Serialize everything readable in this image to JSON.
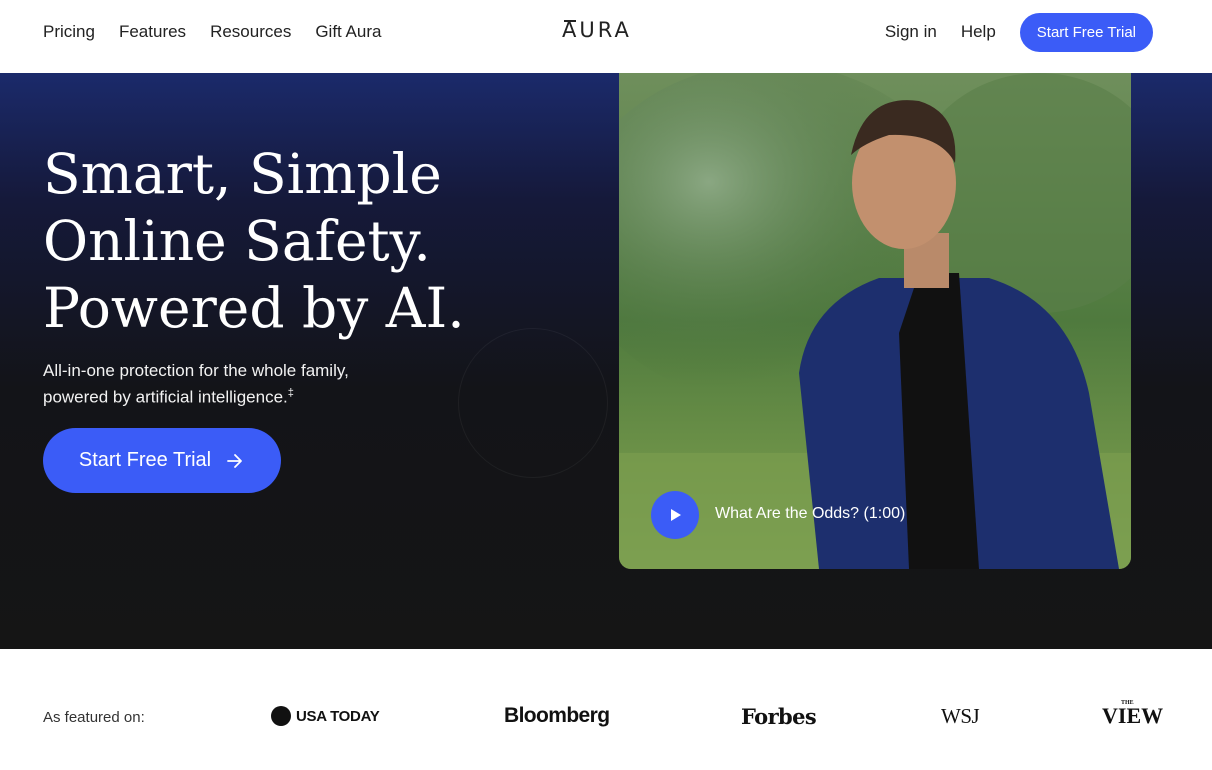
{
  "header": {
    "nav_left": [
      "Pricing",
      "Features",
      "Resources",
      "Gift Aura"
    ],
    "logo": "AURA",
    "sign_in": "Sign in",
    "help": "Help",
    "cta": "Start Free Trial"
  },
  "hero": {
    "headline": [
      "Smart, Simple",
      "Online Safety.",
      "Powered by AI."
    ],
    "subtext_line1": "All-in-one protection for the whole family,",
    "subtext_line2": "powered by artificial intelligence.",
    "subtext_footnote": "‡",
    "cta": "Start Free Trial",
    "video_caption": "What Are the Odds? (1:00)"
  },
  "featured": {
    "label": "As featured on:",
    "outlets": [
      "USA TODAY",
      "Bloomberg",
      "Forbes",
      "WSJ",
      "VIEW",
      "THE"
    ]
  },
  "colors": {
    "accent": "#3b5cf7",
    "hero_bg": "#151515",
    "hero_top": "#1b2a6b"
  },
  "icons": {
    "cta_arrow": "arrow-right-icon",
    "play": "play-icon"
  }
}
